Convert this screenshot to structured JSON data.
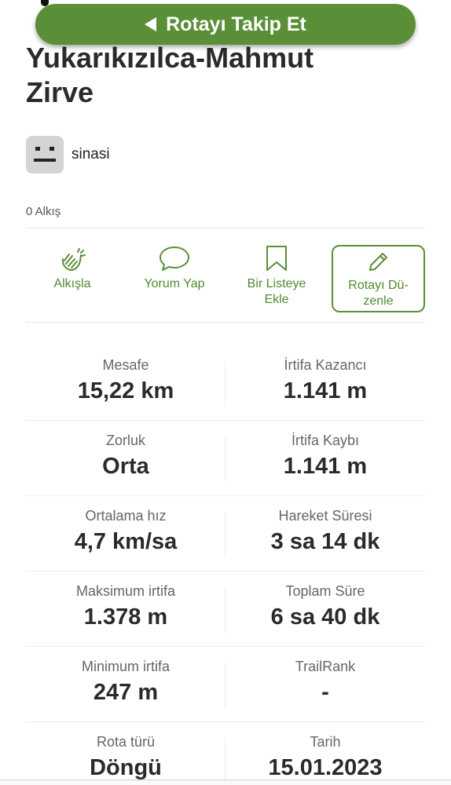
{
  "header": {
    "follow_button_label": "Rotayı Takip Et"
  },
  "route": {
    "title_line1": "Yukarıkızılca-Mahmut",
    "title_line2": "Zirve",
    "username": "sinasi",
    "claps": "0 Alkış"
  },
  "actions": [
    {
      "label": "Alkışla",
      "icon": "clap-icon"
    },
    {
      "label": "Yorum Yap",
      "icon": "comment-icon"
    },
    {
      "label_line1": "Bir Listeye",
      "label_line2": "Ekle",
      "icon": "bookmark-icon"
    },
    {
      "label_line1": "Rotayı Dü-",
      "label_line2": "zenle",
      "icon": "pencil-icon"
    }
  ],
  "stats": [
    {
      "left_label": "Mesafe",
      "left_value": "15,22 km",
      "right_label": "İrtifa Kazancı",
      "right_value": "1.141 m"
    },
    {
      "left_label": "Zorluk",
      "left_value": "Orta",
      "right_label": "İrtifa Kaybı",
      "right_value": "1.141 m"
    },
    {
      "left_label": "Ortalama hız",
      "left_value": "4,7 km/sa",
      "right_label": "Hareket Süresi",
      "right_value": "3 sa 14 dk"
    },
    {
      "left_label": "Maksimum irtifa",
      "left_value": "1.378 m",
      "right_label": "Toplam Süre",
      "right_value": "6 sa 40 dk"
    },
    {
      "left_label": "Minimum irtifa",
      "left_value": "247 m",
      "right_label": "TrailRank",
      "right_value": "-"
    },
    {
      "left_label": "Rota türü",
      "left_value": "Döngü",
      "right_label": "Tarih",
      "right_value": "15.01.2023"
    }
  ],
  "colors": {
    "accent": "#5a8f37",
    "accent_text": "#4e8a2e"
  }
}
